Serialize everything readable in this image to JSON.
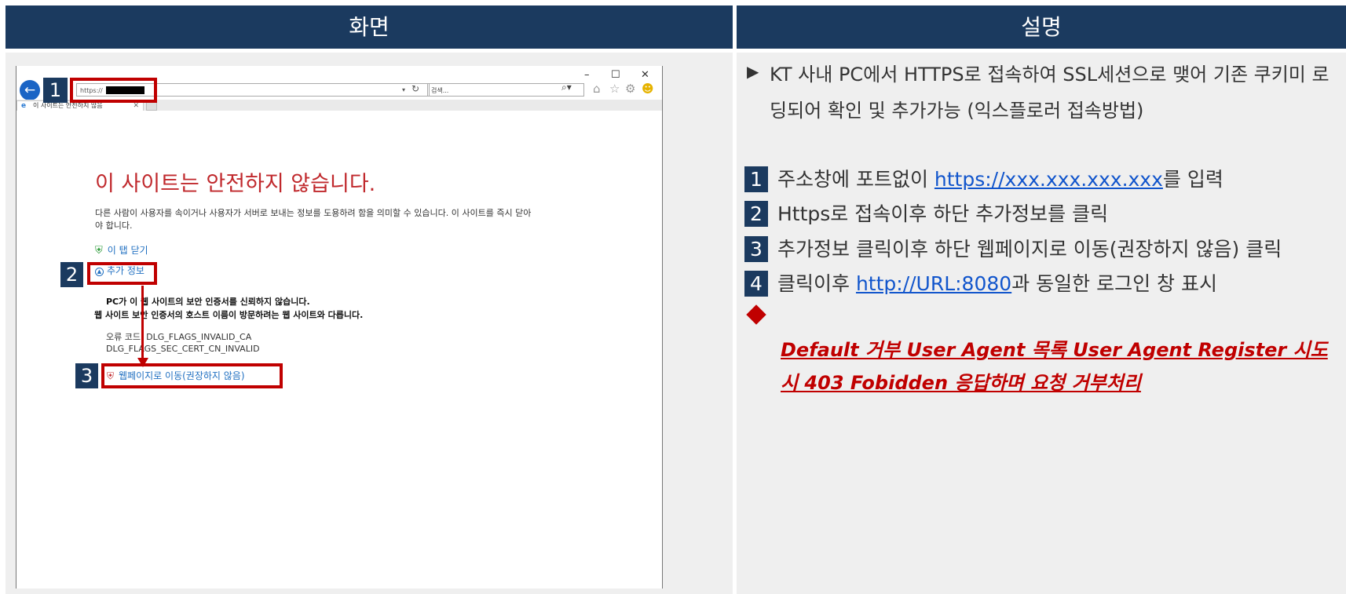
{
  "headers": {
    "screen": "화면",
    "description": "설명"
  },
  "browser": {
    "window_controls": {
      "minimize": "–",
      "maximize": "☐",
      "close": "✕"
    },
    "address_value": "https://",
    "search_placeholder": "검색...",
    "tab_title": "이 사이트는 안전하지 않음",
    "error_title": "이 사이트는 안전하지 않습니다.",
    "error_desc": "다른 사람이 사용자를 속이거나 사용자가 서버로 보내는 정보를 도용하려 함을 의미할 수 있습니다. 이 사이트를 즉시 닫아야 합니다.",
    "close_tab_link": "이 탭 닫기",
    "more_info_link": "추가 정보",
    "cert_msg_1": "PC가 이 웹 사이트의 보안 인증서를 신뢰하지 않습니다.",
    "cert_msg_2": "웹 사이트 보안 인증서의 호스트 이름이 방문하려는 웹 사이트와 다릅니다.",
    "error_code_1": "오류 코드: DLG_FLAGS_INVALID_CA",
    "error_code_2": "DLG_FLAGS_SEC_CERT_CN_INVALID",
    "continue_link": "웹페이지로 이동(권장하지 않음)"
  },
  "markers": [
    "1",
    "2",
    "3"
  ],
  "description": {
    "intro": "KT 사내 PC에서 HTTPS로 접속하여 SSL세션으로 맺어 기존 쿠키미 로딩되어 확인 및 추가가능 (익스플로러 접속방법)",
    "steps": [
      {
        "num": "1",
        "before": "주소창에 포트없이 ",
        "link": "https://xxx.xxx.xxx.xxx",
        "after": "를 입력"
      },
      {
        "num": "2",
        "text": "Https로 접속이후 하단 추가정보를 클릭"
      },
      {
        "num": "3",
        "text": "추가정보 클릭이후 하단 웹페이지로 이동(권장하지 않음) 클릭"
      },
      {
        "num": "4",
        "before": "클릭이후 ",
        "link": "http://URL:8080",
        "after": "과 동일한 로그인 창 표시"
      }
    ],
    "note": "Default 거부 User Agent 목록 User Agent Register 시도 시 403 Fobidden 응답하며 요청 거부처리"
  },
  "colors": {
    "header": "#1b3a5f",
    "accent": "#c00000",
    "error_title": "#c0282c",
    "link": "#1155cc"
  }
}
